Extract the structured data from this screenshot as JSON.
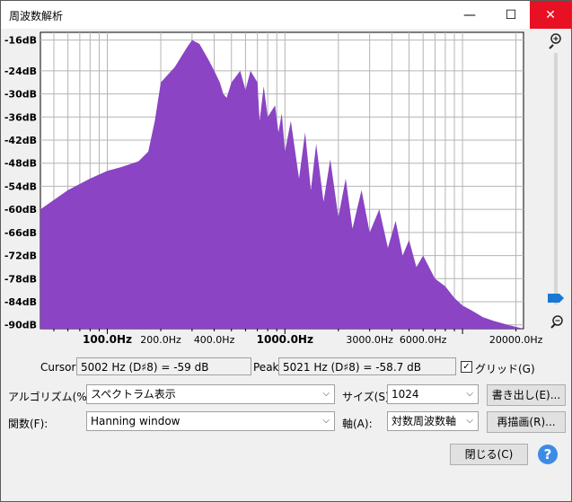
{
  "window": {
    "title": "周波数解析",
    "minimize": "—",
    "maximize": "☐",
    "close": "✕"
  },
  "chart_data": {
    "type": "area",
    "color": "#8a44c4",
    "x_scale": "log",
    "xlim": [
      42,
      22050
    ],
    "ylim": [
      -91,
      -14
    ],
    "grid": true,
    "y_ticks": [
      "-16dB",
      "-24dB",
      "-30dB",
      "-36dB",
      "-42dB",
      "-48dB",
      "-54dB",
      "-60dB",
      "-66dB",
      "-72dB",
      "-78dB",
      "-84dB",
      "-90dB"
    ],
    "y_tick_values": [
      -16,
      -24,
      -30,
      -36,
      -42,
      -48,
      -54,
      -60,
      -66,
      -72,
      -78,
      -84,
      -90
    ],
    "x_ticks": [
      {
        "label": "100.0Hz",
        "value": 100,
        "bold": true
      },
      {
        "label": "200.0Hz",
        "value": 200,
        "bold": false
      },
      {
        "label": "400.0Hz",
        "value": 400,
        "bold": false
      },
      {
        "label": "1000.0Hz",
        "value": 1000,
        "bold": true
      },
      {
        "label": "3000.0Hz",
        "value": 3000,
        "bold": false
      },
      {
        "label": "6000.0Hz",
        "value": 6000,
        "bold": false
      },
      {
        "label": "20000.0Hz",
        "value": 20000,
        "bold": false
      }
    ],
    "x": [
      42,
      60,
      80,
      100,
      120,
      150,
      170,
      185,
      200,
      240,
      280,
      300,
      330,
      360,
      380,
      400,
      430,
      450,
      470,
      500,
      560,
      600,
      640,
      700,
      720,
      760,
      800,
      880,
      920,
      960,
      1000,
      1080,
      1200,
      1300,
      1400,
      1500,
      1650,
      1800,
      2000,
      2200,
      2400,
      2700,
      3000,
      3400,
      3800,
      4200,
      4600,
      5000,
      5500,
      6000,
      7000,
      8000,
      9000,
      10000,
      11000,
      12000,
      13000,
      15000,
      18000,
      22050
    ],
    "y": [
      -60,
      -55,
      -52,
      -50,
      -49,
      -47.5,
      -45,
      -37,
      -27,
      -23,
      -18,
      -16,
      -17,
      -20,
      -22,
      -24,
      -27,
      -30,
      -31,
      -27,
      -24,
      -29,
      -24,
      -27,
      -37,
      -28,
      -36,
      -33,
      -40,
      -35,
      -45,
      -37,
      -52,
      -40,
      -55,
      -43,
      -58,
      -47,
      -62,
      -52,
      -65,
      -55,
      -66,
      -60,
      -70,
      -63,
      -72,
      -68,
      -75,
      -72,
      -78,
      -80,
      -83,
      -85,
      -86,
      -87,
      -88,
      -89,
      -90,
      -91
    ]
  },
  "cursor": {
    "label": "Cursor:",
    "value": "5002 Hz (D♯8) = -59 dB"
  },
  "peak": {
    "label": "Peak:",
    "value": "5021 Hz (D♯8) = -58.7 dB"
  },
  "grid_checkbox": {
    "label": "グリッド(G)",
    "checked": "✓"
  },
  "algorithm": {
    "label": "アルゴリズム(%A):",
    "value": "スペクトラム表示"
  },
  "size": {
    "label": "サイズ(S):",
    "value": "1024"
  },
  "export_button": "書き出し(E)...",
  "function": {
    "label": "関数(F):",
    "value": "Hanning window"
  },
  "axis": {
    "label": "軸(A):",
    "value": "対数周波数軸"
  },
  "redraw_button": "再描画(R)...",
  "close_button": "閉じる(C)",
  "help_button": "?"
}
